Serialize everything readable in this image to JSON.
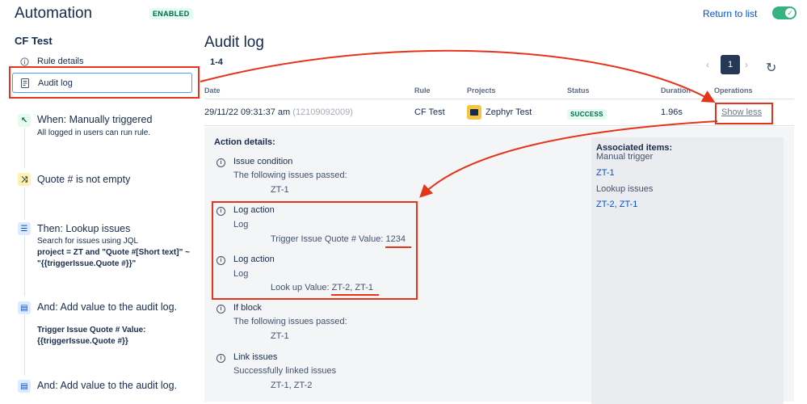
{
  "header": {
    "title": "Automation",
    "status_badge": "ENABLED",
    "return_link": "Return to list",
    "toggle_on": true
  },
  "sidebar": {
    "rule_name": "CF Test",
    "links": [
      {
        "label": "Rule details",
        "icon": "info-icon"
      },
      {
        "label": "Audit log",
        "icon": "document-icon",
        "selected": true
      }
    ],
    "steps": [
      {
        "title": "When: Manually triggered",
        "desc": "All logged in users can run rule.",
        "icon": "cursor-icon",
        "color": "#E3FCEF"
      },
      {
        "title": "Quote # is not empty",
        "icon": "shuffle-icon",
        "color": "#FFF0B3"
      },
      {
        "title": "Then: Lookup issues",
        "desc": "Search for issues using JQL",
        "desc_bold": "project = ZT and \"Quote #[Short text]\" ~ \"{{triggerIssue.Quote #}}\"",
        "icon": "list-icon",
        "color": "#DEEBFF"
      },
      {
        "title": "And: Add value to the audit log.",
        "desc_bold": "Trigger Issue Quote # Value: {{triggerIssue.Quote #}}",
        "icon": "document-icon",
        "color": "#DEEBFF"
      },
      {
        "title": "And: Add value to the audit log.",
        "icon": "document-icon",
        "color": "#DEEBFF"
      }
    ]
  },
  "main": {
    "title": "Audit log",
    "range": "1-4",
    "pager": {
      "prev": "‹",
      "current": "1",
      "next": "›"
    },
    "columns": [
      "Date",
      "Rule",
      "Projects",
      "Status",
      "Duration",
      "Operations"
    ],
    "row": {
      "date": "29/11/22 09:31:37 am",
      "id": "(12109092009)",
      "rule": "CF Test",
      "project": "Zephyr Test",
      "status": "SUCCESS",
      "duration": "1.96s",
      "operation": "Show less"
    },
    "details": {
      "title": "Action details:",
      "actions": [
        {
          "title": "Issue condition",
          "sub": "The following issues passed:",
          "value": "ZT-1"
        },
        {
          "title": "Log action",
          "sub": "Log",
          "value_prefix": "Trigger Issue Quote # Value: ",
          "value": "1234"
        },
        {
          "title": "Log action",
          "sub": "Log",
          "value_prefix": "Look up Value: ",
          "value": "ZT-2, ZT-1"
        },
        {
          "title": "If block",
          "sub": "The following issues passed:",
          "value": "ZT-1"
        },
        {
          "title": "Link issues",
          "sub": "Successfully linked issues",
          "value": "ZT-1, ZT-2"
        }
      ],
      "associated": {
        "title": "Associated items:",
        "groups": [
          {
            "label": "Manual trigger",
            "value": "ZT-1"
          },
          {
            "label": "Lookup issues",
            "value": "ZT-2, ZT-1"
          }
        ]
      }
    }
  },
  "colors": {
    "highlight": "#E5341A",
    "accent": "#0052CC",
    "success": "#36B37E"
  }
}
